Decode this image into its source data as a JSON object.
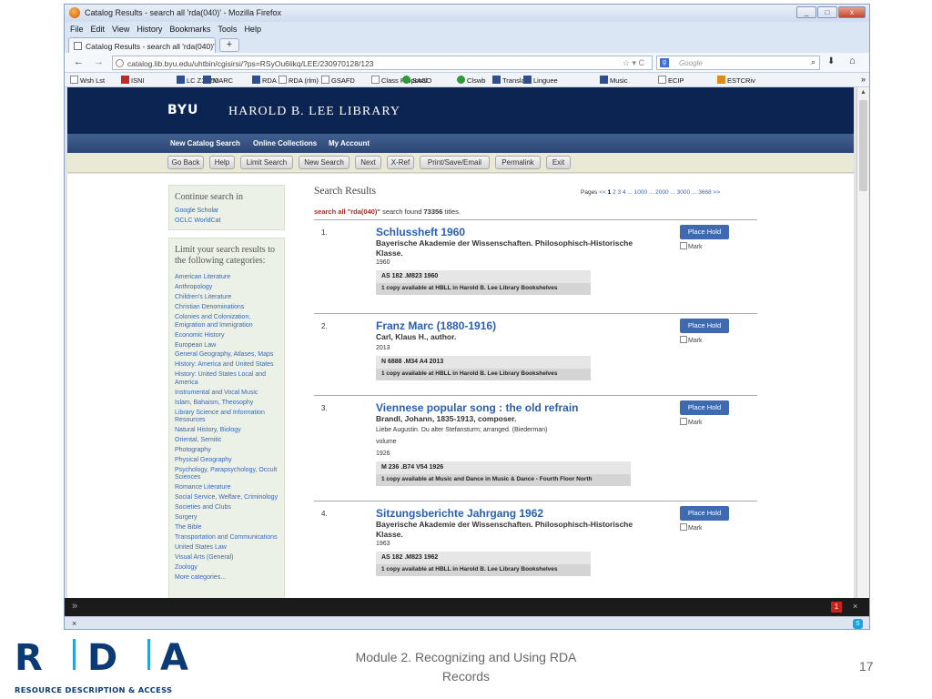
{
  "window": {
    "title": "Catalog Results - search all 'rda(040)' - Mozilla Firefox",
    "controls": [
      "_",
      "□",
      "x"
    ]
  },
  "menu": [
    "File",
    "Edit",
    "View",
    "History",
    "Bookmarks",
    "Tools",
    "Help"
  ],
  "tab": {
    "label": "Catalog Results - search all 'rda(040)'",
    "new_tab": "+"
  },
  "nav": {
    "back": "←",
    "forward": "→",
    "url": "catalog.lib.byu.edu/uhtbin/cgisirsi/?ps=RSyOu6likq/LEE/230970128/123",
    "url_icons": "☆ ▾ C",
    "search_placeholder": "Google",
    "search_engine": "g",
    "search_icon": "⌕",
    "download_icon": "⬇",
    "home_icon": "⌂"
  },
  "bookmarks": [
    "Wsh Lst",
    "ISNI",
    "LC Z39.50",
    "MARC",
    "RDA",
    "RDA (rlm)",
    "GSAFD",
    "Class Proposal",
    "SACO",
    "Clswb",
    "Translate",
    "Linguee",
    "Music",
    "ECIP",
    "ESTCRiv"
  ],
  "bookmarks_more": "»",
  "library": {
    "logo": "BYU",
    "name": "HAROLD B. LEE LIBRARY",
    "topnav": [
      "New Catalog Search",
      "Online Collections",
      "My Account"
    ],
    "buttons": [
      "Go Back",
      "Help",
      "Limit Search",
      "New Search",
      "Next",
      "X-Ref",
      "Print/Save/Email",
      "Permalink",
      "Exit"
    ]
  },
  "sidebar": {
    "continue_heading": "Continue search in",
    "continue_links": [
      "Google Scholar",
      "OCLC WorldCat"
    ],
    "limit_heading": "Limit your search results to the following categories:",
    "categories": [
      "American Literature",
      "Anthropology",
      "Children's Literature",
      "Christian Denominations",
      "Colonies and Colonization, Emigration and Immigration",
      "Economic History",
      "European Law",
      "General Geography, Atlases, Maps",
      "History: America and United States",
      "History: United States Local and America",
      "Instrumental and Vocal Music",
      "Islam, Bahaism, Theosophy",
      "Library Science and Information Resources",
      "Natural History, Biology",
      "Oriental, Semitic",
      "Photography",
      "Physical Geography",
      "Psychology, Parapsychology, Occult Sciences",
      "Romance Literature",
      "Social Service, Welfare, Criminology",
      "Societies and Clubs",
      "Surgery",
      "The Bible",
      "Transportation and Communications",
      "United States Law",
      "Visual Arts (General)",
      "Zoology",
      "More categories..."
    ]
  },
  "results": {
    "heading": "Search Results",
    "pages_label": "Pages",
    "pages": [
      "<<",
      "1",
      "2",
      "3",
      "4",
      "...",
      "1000",
      "...",
      "2000",
      "...",
      "3000",
      "...",
      "3668",
      ">>"
    ],
    "query_text": "search all \"rda(040)\"",
    "found_prefix": " search found ",
    "found_count": "73356",
    "found_suffix": " titles.",
    "place_hold": "Place Hold",
    "mark": "Mark",
    "records": [
      {
        "num": "1.",
        "title": "Schlussheft 1960",
        "author": "Bayerische Akademie der Wissenschaften. Philosophisch-Historische Klasse.",
        "extra": [],
        "year": "1960",
        "callno": "AS 182 .M823 1960",
        "avail": "1 copy available at HBLL in Harold B. Lee Library Bookshelves"
      },
      {
        "num": "2.",
        "title": "Franz Marc (1880-1916)",
        "author": "Carl, Klaus H., author.",
        "extra": [],
        "year": "2013",
        "callno": "N 6888 .M34 A4 2013",
        "avail": "1 copy available at HBLL in Harold B. Lee Library Bookshelves"
      },
      {
        "num": "3.",
        "title": "Viennese popular song : the old refrain",
        "author": "Brandl, Johann, 1835-1913, composer.",
        "extra": [
          "Liebe Augustin. Du alter Stefansturm; arranged. (Biederman)",
          "volume"
        ],
        "year": "1926",
        "callno": "M 236 .B74 V54 1926",
        "avail": "1 copy available at Music and Dance in Music & Dance - Fourth Floor North"
      },
      {
        "num": "4.",
        "title": "Sitzungsberichte Jahrgang 1962",
        "author": "Bayerische Akademie der Wissenschaften. Philosophisch-Historische Klasse.",
        "extra": [],
        "year": "1963",
        "callno": "AS 182 .M823 1962",
        "avail": "1 copy available at HBLL in Harold B. Lee Library Bookshelves"
      }
    ]
  },
  "addon_bar": {
    "left": "»",
    "badge": "1",
    "close": "×"
  },
  "status_bar": {
    "close": "×",
    "skype": "S"
  },
  "slide": {
    "rda_letters": [
      "R",
      "D",
      "A"
    ],
    "rda_subtitle": "RESOURCE DESCRIPTION & ACCESS",
    "footer_line1": "Module 2. Recognizing and Using RDA",
    "footer_line2": "Records",
    "page_number": "17"
  },
  "colors": {
    "header": "#0b2451",
    "link": "#2a5fb0",
    "hold": "#3f6ab0",
    "rda": "#0b3a74",
    "rda_accent": "#29a3d6"
  }
}
